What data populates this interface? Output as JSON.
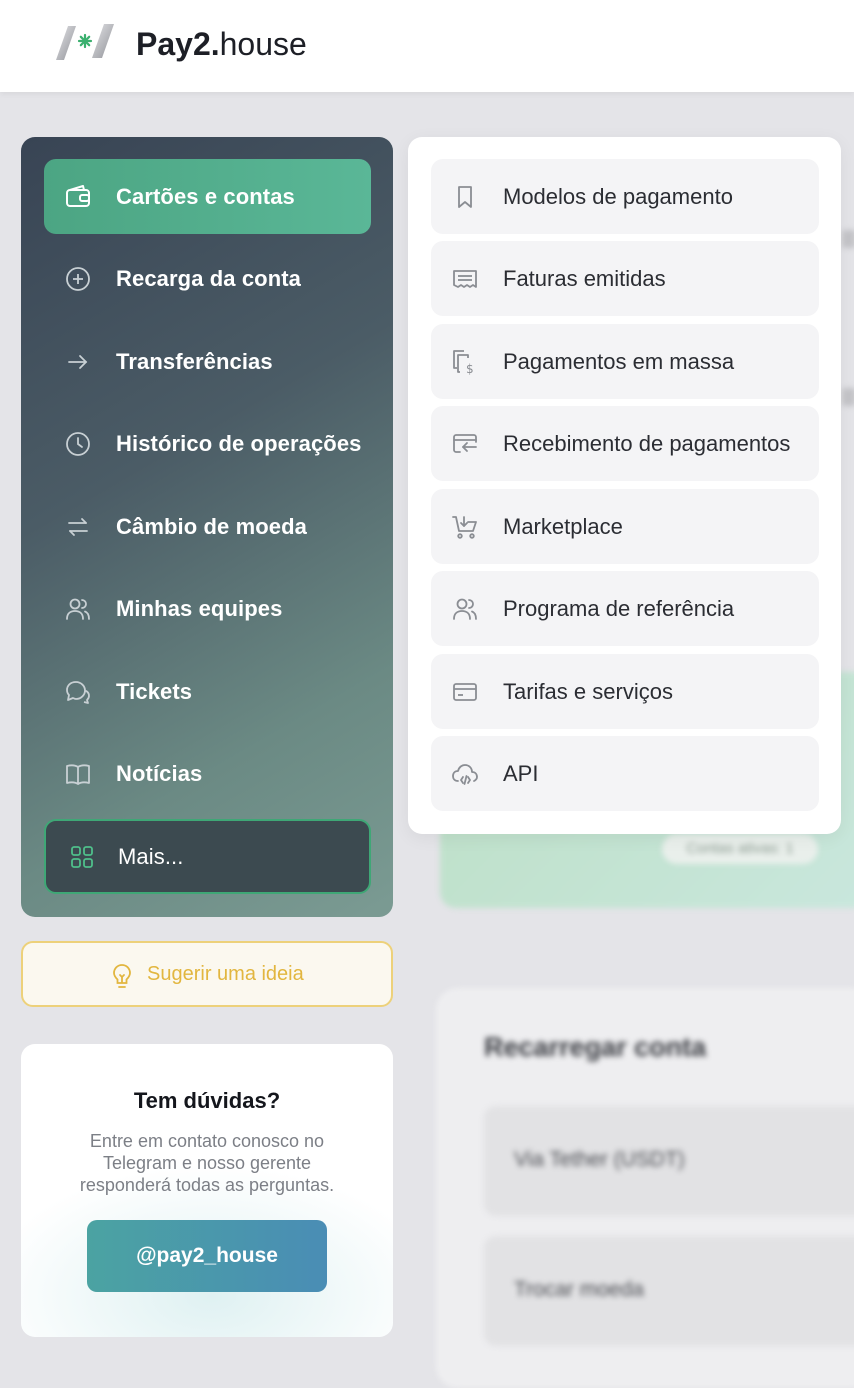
{
  "brand": {
    "name_bold": "Pay2.",
    "name_regular": "house"
  },
  "colors": {
    "accent": "#4ca583",
    "suggest": "#e2b63f",
    "button": "#4a96ad"
  },
  "sidebar": {
    "items": [
      {
        "label": "Cartões e contas",
        "icon": "wallet-icon",
        "active": true
      },
      {
        "label": "Recarga da conta",
        "icon": "plus-circle-icon"
      },
      {
        "label": "Transferências",
        "icon": "arrow-right-icon"
      },
      {
        "label": "Histórico de operações",
        "icon": "clock-icon"
      },
      {
        "label": "Câmbio de moeda",
        "icon": "exchange-arrows-icon"
      },
      {
        "label": "Minhas equipes",
        "icon": "users-icon"
      },
      {
        "label": "Tickets",
        "icon": "chat-bubbles-icon"
      },
      {
        "label": "Notícias",
        "icon": "book-icon"
      }
    ],
    "more_label": "Mais..."
  },
  "suggest": {
    "label": "Sugerir uma ideia",
    "icon": "lightbulb-icon"
  },
  "help": {
    "title": "Tem dúvidas?",
    "text": "Entre em contato conosco no Telegram e nosso gerente responderá todas as perguntas.",
    "button_label": "@pay2_house"
  },
  "dropdown": {
    "items": [
      {
        "label": "Modelos de pagamento",
        "icon": "bookmark-icon"
      },
      {
        "label": "Faturas emitidas",
        "icon": "receipt-icon"
      },
      {
        "label": "Pagamentos em massa",
        "icon": "mass-payment-icon"
      },
      {
        "label": "Recebimento de pagamentos",
        "icon": "card-receive-icon"
      },
      {
        "label": "Marketplace",
        "icon": "cart-icon"
      },
      {
        "label": "Programa de referência",
        "icon": "users-icon"
      },
      {
        "label": "Tarifas e serviços",
        "icon": "credit-card-icon"
      },
      {
        "label": "API",
        "icon": "cloud-code-icon"
      }
    ]
  },
  "background": {
    "pill": "Contas ativas: 1",
    "card_title": "Recarregar conta",
    "rows": [
      "Via Tether (USDT)",
      "Trocar moeda"
    ]
  }
}
